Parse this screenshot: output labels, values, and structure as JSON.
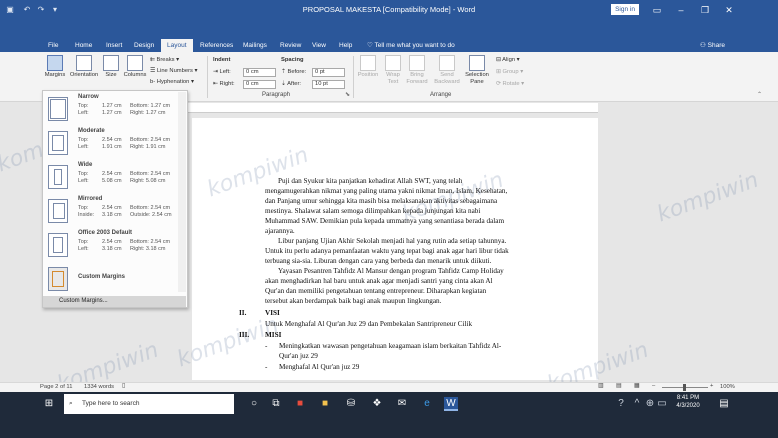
{
  "window": {
    "title": "PROPOSAL MAKESTA [Compatibility Mode] - Word",
    "signin": "Sign in"
  },
  "tabs": [
    "File",
    "Home",
    "Insert",
    "Design",
    "Layout",
    "References",
    "Mailings",
    "Review",
    "View",
    "Help"
  ],
  "active_tab": "Layout",
  "tellme": "Tell me what you want to do",
  "share": "Share",
  "ribbon": {
    "margins": "Margins",
    "orientation": "Orientation",
    "size": "Size",
    "columns": "Columns",
    "breaks": "Breaks",
    "line_numbers": "Line Numbers",
    "hyphenation": "Hyphenation",
    "indent_title": "Indent",
    "spacing_title": "Spacing",
    "left_label": "Left:",
    "right_label": "Right:",
    "before_label": "Before:",
    "after_label": "After:",
    "left_value": "0 cm",
    "right_value": "0 cm",
    "before_value": "0 pt",
    "after_value": "10 pt",
    "paragraph_group": "Paragraph",
    "arrange_group": "Arrange",
    "position": "Position",
    "wrap_text": "Wrap Text",
    "bring_forward": "Bring Forward",
    "send_backward": "Send Backward",
    "selection_pane": "Selection Pane",
    "align": "Align",
    "group": "Group",
    "rotate": "Rotate"
  },
  "margins_menu": {
    "items": [
      {
        "name": "Narrow",
        "r1": [
          "Top:",
          "1.27 cm",
          "Bottom: 1.27 cm"
        ],
        "r2": [
          "Left:",
          "1.27 cm",
          "Right:   1.27 cm"
        ]
      },
      {
        "name": "Moderate",
        "r1": [
          "Top:",
          "2.54 cm",
          "Bottom: 2.54 cm"
        ],
        "r2": [
          "Left:",
          "1.91 cm",
          "Right:   1.91 cm"
        ]
      },
      {
        "name": "Wide",
        "r1": [
          "Top:",
          "2.54 cm",
          "Bottom: 2.54 cm"
        ],
        "r2": [
          "Left:",
          "5.08 cm",
          "Right:   5.08 cm"
        ]
      },
      {
        "name": "Mirrored",
        "r1": [
          "Top:",
          "2.54 cm",
          "Bottom: 2.54 cm"
        ],
        "r2": [
          "Inside:",
          "3.18 cm",
          "Outside: 2.54 cm"
        ]
      },
      {
        "name": "Office 2003 Default",
        "r1": [
          "Top:",
          "2.54 cm",
          "Bottom: 2.54 cm"
        ],
        "r2": [
          "Left:",
          "3.18 cm",
          "Right:   3.18 cm"
        ]
      }
    ],
    "custom_margins_item": "Custom Margins",
    "custom_margins_link": "Custom Margins..."
  },
  "document": {
    "lines": [
      "Puji  dan  Syukur  kita  panjatkan  kehadirat  Allah  SWT,  yang  telah",
      "mengamugerahkan nikmat yang paling utama yakni nikmat Iman, Islam, Kesehatan,",
      "dan Panjang umur sehingga kita masih bisa melaksanakan aktivitas sebagaimana",
      "mestinya.  Shalawat  salam  semoga  dilimpahkan  kepada  junjungan  kita  nabi",
      "Muhammad SAW. Demikian pula kepada ummatnya yang senantiasa berada dalam",
      "ajarannya.",
      "Libur panjang Ujian Akhir Sekolah menjadi hal yang rutin ada setiap tahunnya.",
      "Untuk itu perlu adanya pemanfaatan waktu yang tepat bagi anak agar hari libur tidak",
      "terbuang sia-sia. Liburan dengan cara yang berbeda dan menarik untuk diikuti.",
      "Yayasan Pesantren Tahfidz Al Mansur dengan program Tahfidz Camp Holiday",
      "akan menghadirkan hal baru untuk anak agar menjadi santri yang cinta akan Al",
      "Qur'an   dan   memiliki pengetahuan tentang entrepreneur. Diharapkan kegiatan",
      "tersebut akan berdampak baik bagi anak maupun lingkungan."
    ],
    "sections": [
      {
        "num": "II.",
        "heading": "VISI",
        "text": "Untuk Menghafal Al Qur'an Juz 29 dan Pembekalan Santripreneur Cilik"
      },
      {
        "num": "III.",
        "heading": "MISI"
      }
    ],
    "misi": [
      "Meningkatkan wawasan pengetahuan keagamaan islam berkaitan Tahfidz Al-",
      "Qur'an juz 29",
      "Menghafal Al Qur'an juz 29"
    ],
    "watermark": "kompiwin"
  },
  "status": {
    "page": "Page 2 of 11",
    "words": "1334 words",
    "zoom": "100%"
  },
  "taskbar": {
    "search_placeholder": "Type here to search",
    "time": "8:41 PM",
    "date": "4/3/2020"
  },
  "colors": {
    "word_blue": "#2b579a",
    "taskbar": "#1f2a3a"
  }
}
